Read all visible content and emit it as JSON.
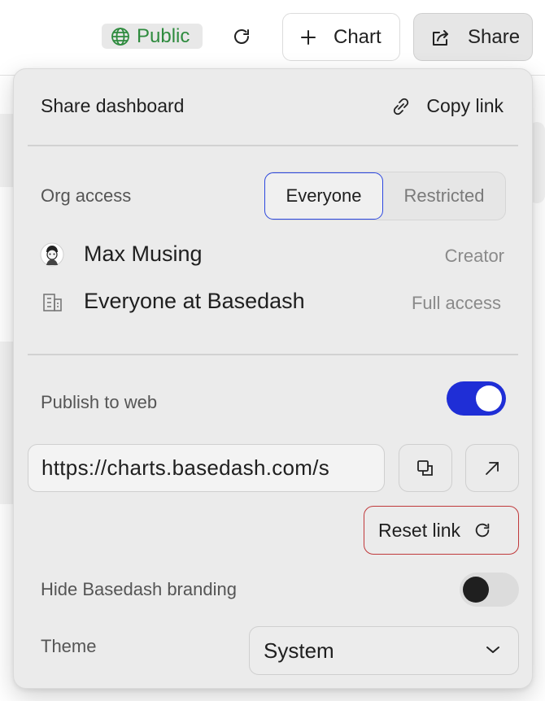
{
  "toolbar": {
    "visibility_label": "Public",
    "chart_button": "Chart",
    "share_button": "Share"
  },
  "share_panel": {
    "title": "Share dashboard",
    "copy_link": "Copy link",
    "org_access": {
      "label": "Org access",
      "options": [
        "Everyone",
        "Restricted"
      ],
      "selected": "Everyone"
    },
    "members": [
      {
        "name": "Max Musing",
        "role": "Creator",
        "icon": "avatar"
      },
      {
        "name": "Everyone at Basedash",
        "role": "Full access",
        "icon": "building-icon"
      }
    ],
    "publish": {
      "label": "Publish to web",
      "enabled": true,
      "url": "https://charts.basedash.com/s",
      "reset_label": "Reset link"
    },
    "branding": {
      "label": "Hide Basedash branding",
      "enabled": false
    },
    "theme": {
      "label": "Theme",
      "value": "System"
    }
  },
  "colors": {
    "accent": "#1f2ed6",
    "public_green": "#2e8b3e",
    "danger_border": "#c0393b"
  }
}
